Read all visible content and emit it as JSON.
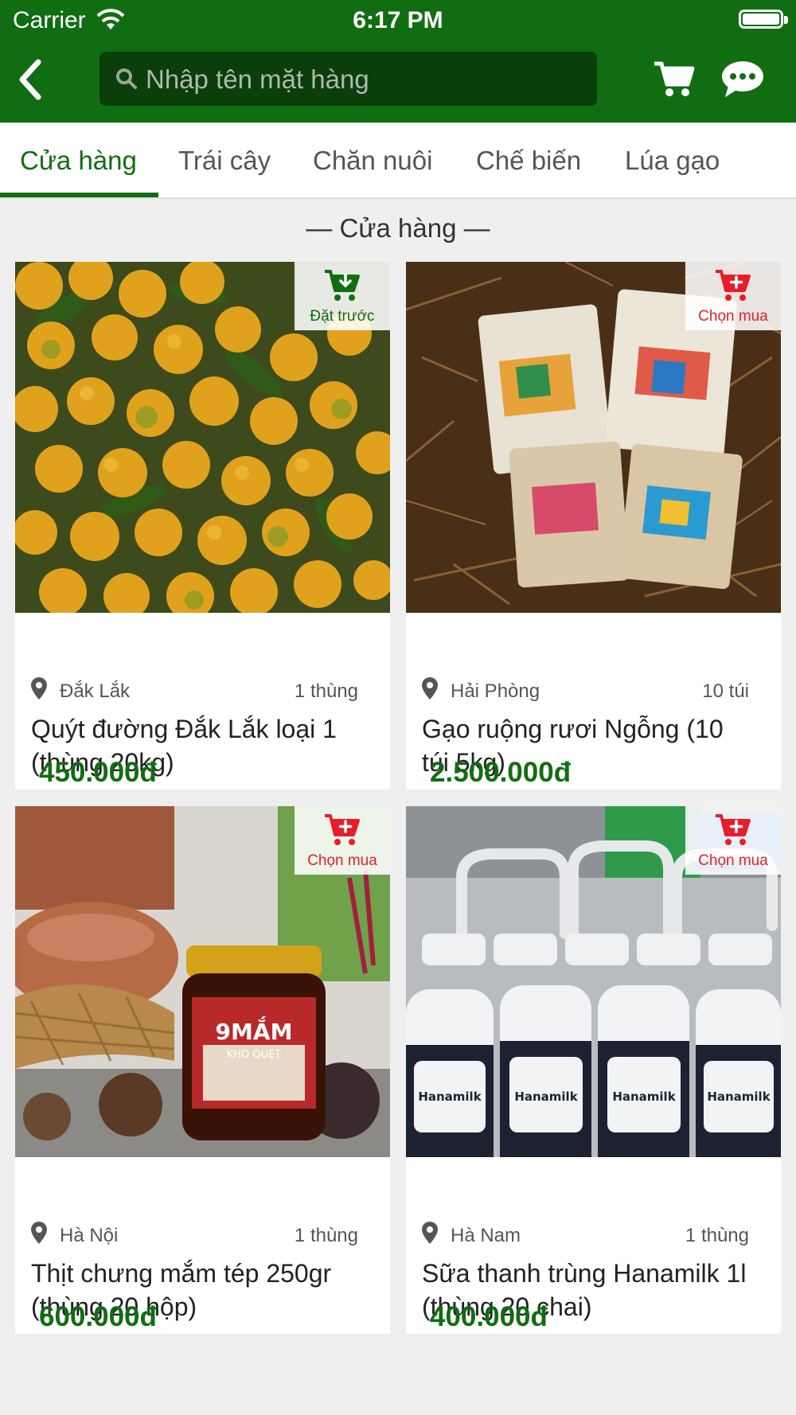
{
  "status_bar": {
    "carrier": "Carrier",
    "time": "6:17 PM"
  },
  "header": {
    "search_placeholder": "Nhập tên mặt hàng",
    "search_value": "",
    "icons": [
      "back-chevron-icon",
      "search-icon",
      "cart-icon",
      "chat-bubble-icon"
    ]
  },
  "tabs": [
    "Cửa hàng",
    "Trái cây",
    "Chăn nuôi",
    "Chế biến",
    "Lúa gạo"
  ],
  "active_tab": "Cửa hàng",
  "section_title": "— Cửa hàng —",
  "colors": {
    "brand": "#116d12",
    "accent_red": "#e61e2a"
  },
  "products": [
    {
      "badge": "Đặt trước",
      "badge_icon": "preorder-cart-icon",
      "location": "Đắk Lắk",
      "quantity": "1 thùng",
      "name": "Quýt đường Đắk Lắk loại 1 (thùng 20kg)",
      "price": "450.000đ"
    },
    {
      "badge": "Chọn mua",
      "badge_icon": "add-to-cart-icon",
      "location": "Hải Phòng",
      "quantity": "10 túi",
      "name": "Gạo ruộng rươi Ngỗng (10 túi 5kg)",
      "price": "2.500.000đ"
    },
    {
      "badge": "Chọn mua",
      "badge_icon": "add-to-cart-icon",
      "location": "Hà Nội",
      "quantity": "1 thùng",
      "name": "Thịt chưng mắm tép 250gr (thùng 20 hộp)",
      "price": "600.000đ"
    },
    {
      "badge": "Chọn mua",
      "badge_icon": "add-to-cart-icon",
      "location": "Hà Nam",
      "quantity": "1 thùng",
      "name": "Sữa thanh trùng Hanamilk 1l (thùng 20 chai)",
      "price": "400.000đ"
    }
  ]
}
